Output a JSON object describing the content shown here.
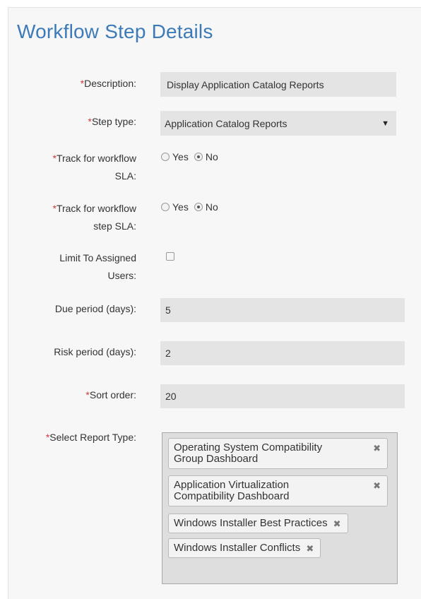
{
  "title": "Workflow Step Details",
  "required_mark": "*",
  "fields": {
    "description": {
      "label": "Description:",
      "value": "Display Application Catalog Reports"
    },
    "step_type": {
      "label": "Step type:",
      "value": "Application Catalog Reports"
    },
    "track_workflow_sla": {
      "label_line1": "Track for workflow",
      "label_line2": "SLA:",
      "yes": "Yes",
      "no": "No",
      "selected": "No"
    },
    "track_step_sla": {
      "label_line1": "Track for workflow",
      "label_line2": "step SLA:",
      "yes": "Yes",
      "no": "No",
      "selected": "No"
    },
    "limit_users": {
      "label_line1": "Limit To Assigned",
      "label_line2": "Users:",
      "checked": false
    },
    "due_period": {
      "label": "Due period (days):",
      "value": "5"
    },
    "risk_period": {
      "label": "Risk period (days):",
      "value": "2"
    },
    "sort_order": {
      "label": "Sort order:",
      "value": "20"
    },
    "report_type": {
      "label": "Select Report Type:",
      "tags": [
        {
          "line1": "Operating System Compatibility",
          "line2": "Group Dashboard"
        },
        {
          "line1": "Application Virtualization",
          "line2": "Compatibility Dashboard"
        },
        {
          "line1": "Windows Installer Best Practices",
          "line2": ""
        },
        {
          "line1": "Windows Installer Conflicts",
          "line2": ""
        }
      ]
    }
  },
  "icons": {
    "remove": "close-icon",
    "dropdown": "caret-down-icon"
  },
  "colors": {
    "title": "#3d7ab8",
    "required": "#d03b3b",
    "field_bg": "#e4e4e4"
  }
}
